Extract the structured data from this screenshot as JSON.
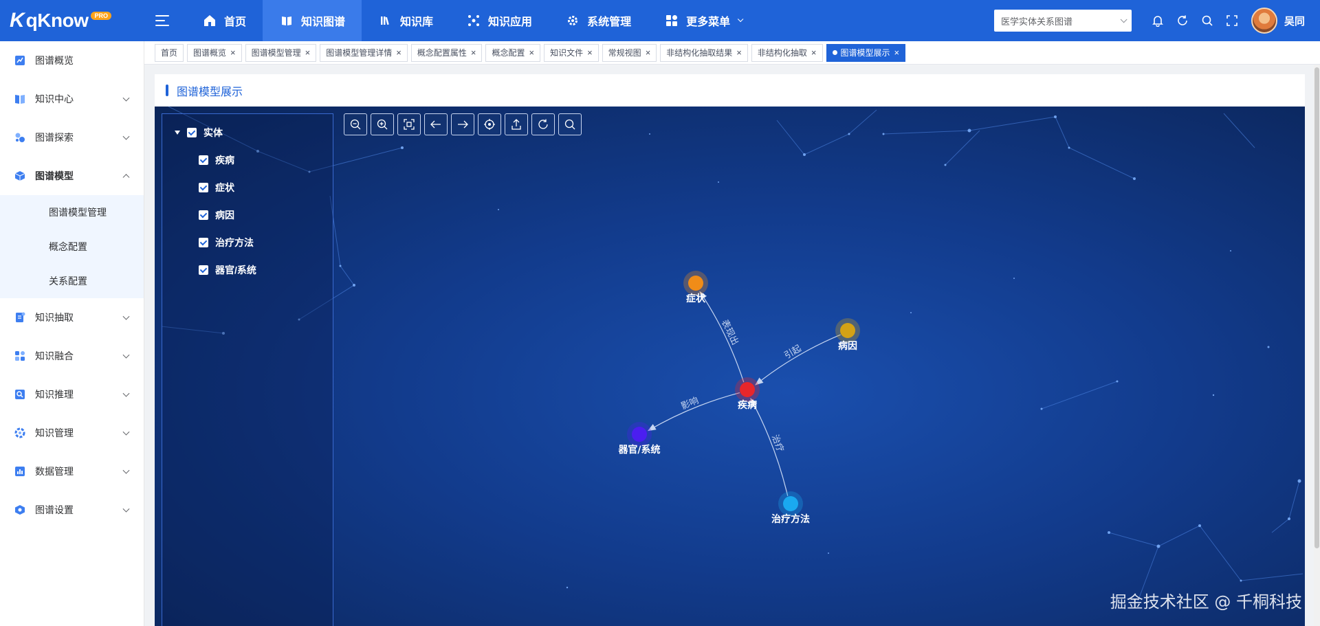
{
  "brand": {
    "name": "qKnow",
    "badge": "PRO"
  },
  "nav": {
    "items": [
      {
        "label": "首页",
        "icon": "home-icon"
      },
      {
        "label": "知识图谱",
        "icon": "book-open-icon",
        "active": true
      },
      {
        "label": "知识库",
        "icon": "library-icon"
      },
      {
        "label": "知识应用",
        "icon": "apps-icon"
      },
      {
        "label": "系统管理",
        "icon": "gear-icon"
      },
      {
        "label": "更多菜单",
        "icon": "grid-icon"
      }
    ]
  },
  "header": {
    "graph_select": "医学实体关系图谱",
    "user_name": "吴同"
  },
  "sidebar": {
    "items": [
      {
        "label": "图谱概览"
      },
      {
        "label": "知识中心"
      },
      {
        "label": "图谱探索"
      },
      {
        "label": "图谱模型",
        "open": true
      },
      {
        "label": "知识抽取"
      },
      {
        "label": "知识融合"
      },
      {
        "label": "知识推理"
      },
      {
        "label": "知识管理"
      },
      {
        "label": "数据管理"
      },
      {
        "label": "图谱设置"
      }
    ],
    "sub_items": [
      "图谱模型管理",
      "概念配置",
      "关系配置"
    ]
  },
  "tabs": [
    {
      "label": "首页",
      "closable": false
    },
    {
      "label": "图谱概览",
      "closable": true
    },
    {
      "label": "图谱模型管理",
      "closable": true
    },
    {
      "label": "图谱模型管理详情",
      "closable": true
    },
    {
      "label": "概念配置属性",
      "closable": true
    },
    {
      "label": "概念配置",
      "closable": true
    },
    {
      "label": "知识文件",
      "closable": true
    },
    {
      "label": "常规视图",
      "closable": true
    },
    {
      "label": "非结构化抽取结果",
      "closable": true
    },
    {
      "label": "非结构化抽取",
      "closable": true
    },
    {
      "label": "图谱模型展示",
      "closable": true,
      "active": true
    }
  ],
  "tab_close_glyph": "×",
  "page_title": "图谱模型展示",
  "tree": {
    "root": "实体",
    "children": [
      "疾病",
      "症状",
      "病因",
      "治疗方法",
      "器官/系统"
    ]
  },
  "toolbar": [
    "zoom-out-icon",
    "zoom-in-icon",
    "fit-view-icon",
    "undo-icon",
    "redo-icon",
    "locate-icon",
    "export-icon",
    "refresh-icon",
    "search-icon"
  ],
  "graph": {
    "nodes": [
      {
        "id": "disease",
        "label": "疾病",
        "color": "#e8262b"
      },
      {
        "id": "symptom",
        "label": "症状",
        "color": "#f08c18"
      },
      {
        "id": "cause",
        "label": "病因",
        "color": "#d4a215"
      },
      {
        "id": "organ",
        "label": "器官/系统",
        "color": "#4b1ef0"
      },
      {
        "id": "treatment",
        "label": "治疗方法",
        "color": "#1aa9f0"
      }
    ],
    "edges": [
      {
        "from": "disease",
        "to": "symptom",
        "label": "表现出"
      },
      {
        "from": "cause",
        "to": "disease",
        "label": "引起"
      },
      {
        "from": "disease",
        "to": "organ",
        "label": "影响"
      },
      {
        "from": "treatment",
        "to": "disease",
        "label": "治疗"
      }
    ]
  },
  "watermark": "掘金技术社区 @ 千桐科技"
}
